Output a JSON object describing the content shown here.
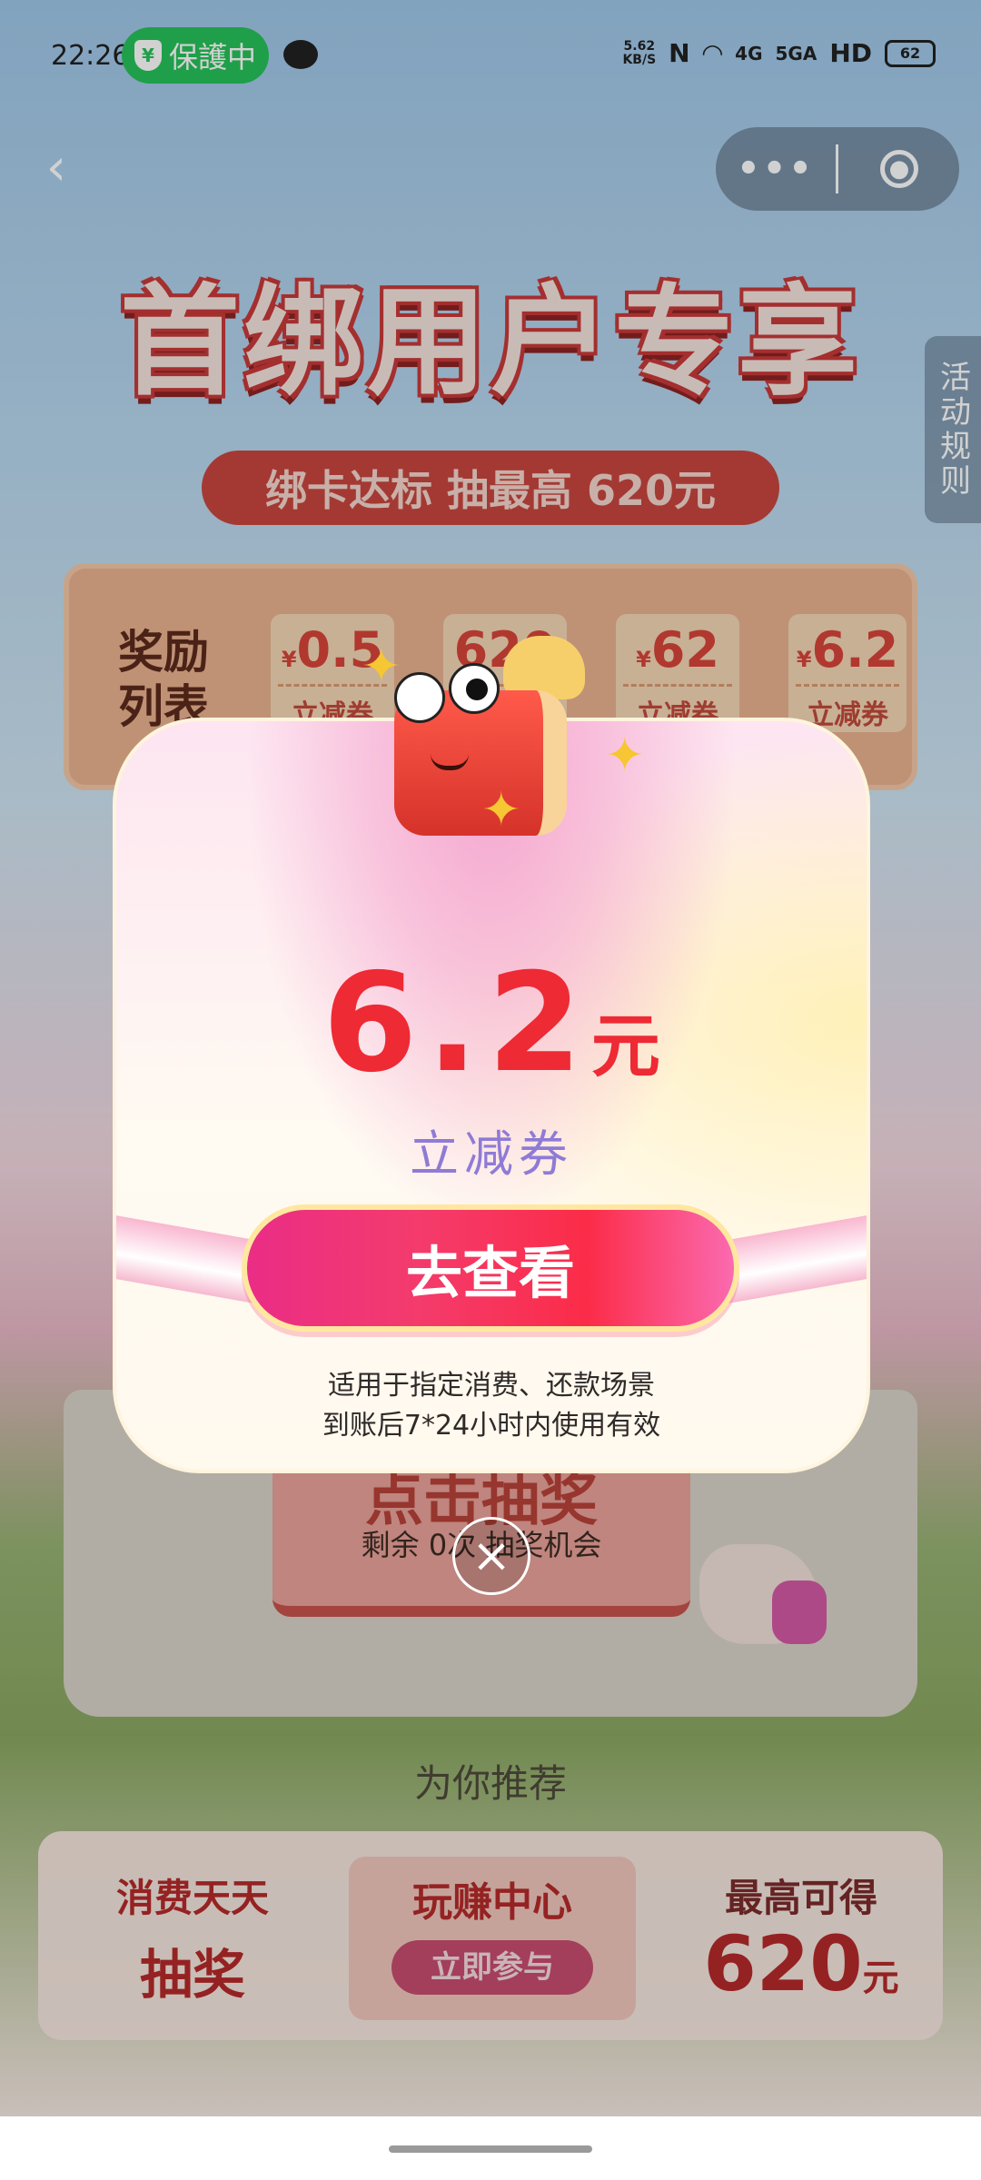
{
  "status_bar": {
    "time": "22:26",
    "protect_label": "保護中",
    "protect_icon": "shield-icon",
    "net_speed_value": "5.62",
    "net_speed_unit": "KB/S",
    "nfc": "N",
    "signal_1": "4G",
    "signal_2": "5GA",
    "hd": "HD",
    "battery": "62"
  },
  "nav": {
    "back_icon": "back-arrow-icon",
    "more_icon": "more-dots-icon",
    "close_icon": "close-circle-icon"
  },
  "hero": {
    "title": "首绑用户专享",
    "subtitle": "绑卡达标 抽最高 620元",
    "rules_tab": "活动规则"
  },
  "reward_list": {
    "title": "奖励列表",
    "items": [
      {
        "currency": "¥",
        "value": "0.5",
        "type": "立减券"
      },
      {
        "currency": "",
        "value": "620",
        "type": ""
      },
      {
        "currency": "¥",
        "value": "62",
        "type": "立减券"
      },
      {
        "currency": "¥",
        "value": "6.2",
        "type": "立减券"
      }
    ]
  },
  "draw": {
    "button_label": "点击抽奖",
    "remaining": "剩余 0次 抽奖机会"
  },
  "recommend_label": "为你推荐",
  "bottom_bar": {
    "left_line1": "消费天天",
    "left_line2": "抽奖",
    "mid_title": "玩赚中心",
    "mid_button": "立即参与",
    "right_line1": "最高可得",
    "right_value": "620",
    "right_unit": "元"
  },
  "modal": {
    "amount": "6.2",
    "unit": "元",
    "coupon_type": "立减券",
    "view_button": "去查看",
    "note_line1": "适用于指定消费、还款场景",
    "note_line2": "到账后7*24小时内使用有效",
    "close_icon": "close-x-icon",
    "mascot": "gift-box-mascot-icon"
  },
  "colors": {
    "accent_red": "#ee2a34",
    "coupon_purple": "#8f7bd5",
    "button_pink": "#f43b6c",
    "protect_green": "#27c35a"
  }
}
